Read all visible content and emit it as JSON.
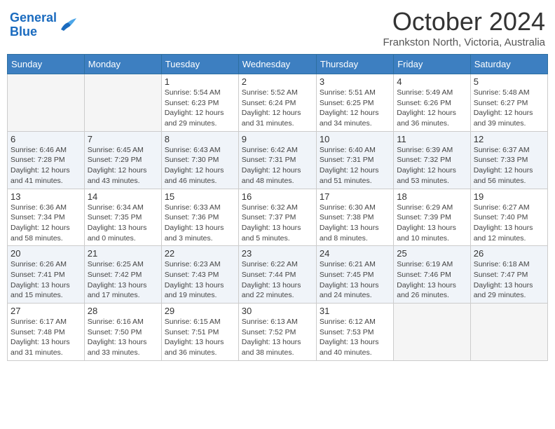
{
  "header": {
    "logo_line1": "General",
    "logo_line2": "Blue",
    "month": "October 2024",
    "location": "Frankston North, Victoria, Australia"
  },
  "weekdays": [
    "Sunday",
    "Monday",
    "Tuesday",
    "Wednesday",
    "Thursday",
    "Friday",
    "Saturday"
  ],
  "weeks": [
    [
      {
        "day": "",
        "sunrise": "",
        "sunset": "",
        "daylight": ""
      },
      {
        "day": "",
        "sunrise": "",
        "sunset": "",
        "daylight": ""
      },
      {
        "day": "1",
        "sunrise": "Sunrise: 5:54 AM",
        "sunset": "Sunset: 6:23 PM",
        "daylight": "Daylight: 12 hours and 29 minutes."
      },
      {
        "day": "2",
        "sunrise": "Sunrise: 5:52 AM",
        "sunset": "Sunset: 6:24 PM",
        "daylight": "Daylight: 12 hours and 31 minutes."
      },
      {
        "day": "3",
        "sunrise": "Sunrise: 5:51 AM",
        "sunset": "Sunset: 6:25 PM",
        "daylight": "Daylight: 12 hours and 34 minutes."
      },
      {
        "day": "4",
        "sunrise": "Sunrise: 5:49 AM",
        "sunset": "Sunset: 6:26 PM",
        "daylight": "Daylight: 12 hours and 36 minutes."
      },
      {
        "day": "5",
        "sunrise": "Sunrise: 5:48 AM",
        "sunset": "Sunset: 6:27 PM",
        "daylight": "Daylight: 12 hours and 39 minutes."
      }
    ],
    [
      {
        "day": "6",
        "sunrise": "Sunrise: 6:46 AM",
        "sunset": "Sunset: 7:28 PM",
        "daylight": "Daylight: 12 hours and 41 minutes."
      },
      {
        "day": "7",
        "sunrise": "Sunrise: 6:45 AM",
        "sunset": "Sunset: 7:29 PM",
        "daylight": "Daylight: 12 hours and 43 minutes."
      },
      {
        "day": "8",
        "sunrise": "Sunrise: 6:43 AM",
        "sunset": "Sunset: 7:30 PM",
        "daylight": "Daylight: 12 hours and 46 minutes."
      },
      {
        "day": "9",
        "sunrise": "Sunrise: 6:42 AM",
        "sunset": "Sunset: 7:31 PM",
        "daylight": "Daylight: 12 hours and 48 minutes."
      },
      {
        "day": "10",
        "sunrise": "Sunrise: 6:40 AM",
        "sunset": "Sunset: 7:31 PM",
        "daylight": "Daylight: 12 hours and 51 minutes."
      },
      {
        "day": "11",
        "sunrise": "Sunrise: 6:39 AM",
        "sunset": "Sunset: 7:32 PM",
        "daylight": "Daylight: 12 hours and 53 minutes."
      },
      {
        "day": "12",
        "sunrise": "Sunrise: 6:37 AM",
        "sunset": "Sunset: 7:33 PM",
        "daylight": "Daylight: 12 hours and 56 minutes."
      }
    ],
    [
      {
        "day": "13",
        "sunrise": "Sunrise: 6:36 AM",
        "sunset": "Sunset: 7:34 PM",
        "daylight": "Daylight: 12 hours and 58 minutes."
      },
      {
        "day": "14",
        "sunrise": "Sunrise: 6:34 AM",
        "sunset": "Sunset: 7:35 PM",
        "daylight": "Daylight: 13 hours and 0 minutes."
      },
      {
        "day": "15",
        "sunrise": "Sunrise: 6:33 AM",
        "sunset": "Sunset: 7:36 PM",
        "daylight": "Daylight: 13 hours and 3 minutes."
      },
      {
        "day": "16",
        "sunrise": "Sunrise: 6:32 AM",
        "sunset": "Sunset: 7:37 PM",
        "daylight": "Daylight: 13 hours and 5 minutes."
      },
      {
        "day": "17",
        "sunrise": "Sunrise: 6:30 AM",
        "sunset": "Sunset: 7:38 PM",
        "daylight": "Daylight: 13 hours and 8 minutes."
      },
      {
        "day": "18",
        "sunrise": "Sunrise: 6:29 AM",
        "sunset": "Sunset: 7:39 PM",
        "daylight": "Daylight: 13 hours and 10 minutes."
      },
      {
        "day": "19",
        "sunrise": "Sunrise: 6:27 AM",
        "sunset": "Sunset: 7:40 PM",
        "daylight": "Daylight: 13 hours and 12 minutes."
      }
    ],
    [
      {
        "day": "20",
        "sunrise": "Sunrise: 6:26 AM",
        "sunset": "Sunset: 7:41 PM",
        "daylight": "Daylight: 13 hours and 15 minutes."
      },
      {
        "day": "21",
        "sunrise": "Sunrise: 6:25 AM",
        "sunset": "Sunset: 7:42 PM",
        "daylight": "Daylight: 13 hours and 17 minutes."
      },
      {
        "day": "22",
        "sunrise": "Sunrise: 6:23 AM",
        "sunset": "Sunset: 7:43 PM",
        "daylight": "Daylight: 13 hours and 19 minutes."
      },
      {
        "day": "23",
        "sunrise": "Sunrise: 6:22 AM",
        "sunset": "Sunset: 7:44 PM",
        "daylight": "Daylight: 13 hours and 22 minutes."
      },
      {
        "day": "24",
        "sunrise": "Sunrise: 6:21 AM",
        "sunset": "Sunset: 7:45 PM",
        "daylight": "Daylight: 13 hours and 24 minutes."
      },
      {
        "day": "25",
        "sunrise": "Sunrise: 6:19 AM",
        "sunset": "Sunset: 7:46 PM",
        "daylight": "Daylight: 13 hours and 26 minutes."
      },
      {
        "day": "26",
        "sunrise": "Sunrise: 6:18 AM",
        "sunset": "Sunset: 7:47 PM",
        "daylight": "Daylight: 13 hours and 29 minutes."
      }
    ],
    [
      {
        "day": "27",
        "sunrise": "Sunrise: 6:17 AM",
        "sunset": "Sunset: 7:48 PM",
        "daylight": "Daylight: 13 hours and 31 minutes."
      },
      {
        "day": "28",
        "sunrise": "Sunrise: 6:16 AM",
        "sunset": "Sunset: 7:50 PM",
        "daylight": "Daylight: 13 hours and 33 minutes."
      },
      {
        "day": "29",
        "sunrise": "Sunrise: 6:15 AM",
        "sunset": "Sunset: 7:51 PM",
        "daylight": "Daylight: 13 hours and 36 minutes."
      },
      {
        "day": "30",
        "sunrise": "Sunrise: 6:13 AM",
        "sunset": "Sunset: 7:52 PM",
        "daylight": "Daylight: 13 hours and 38 minutes."
      },
      {
        "day": "31",
        "sunrise": "Sunrise: 6:12 AM",
        "sunset": "Sunset: 7:53 PM",
        "daylight": "Daylight: 13 hours and 40 minutes."
      },
      {
        "day": "",
        "sunrise": "",
        "sunset": "",
        "daylight": ""
      },
      {
        "day": "",
        "sunrise": "",
        "sunset": "",
        "daylight": ""
      }
    ]
  ]
}
